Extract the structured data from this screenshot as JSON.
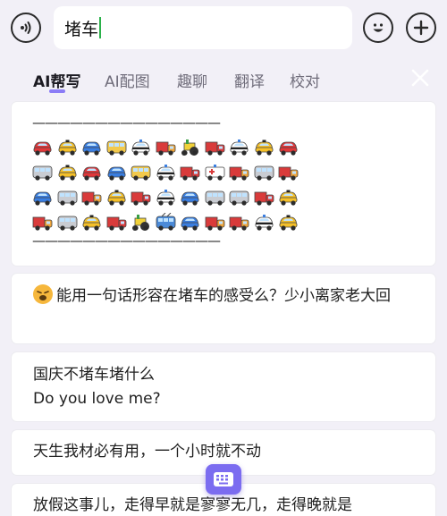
{
  "input": {
    "text": "堵车"
  },
  "tabs": [
    {
      "label": "AI帮写",
      "active": true
    },
    {
      "label": "AI配图",
      "active": false
    },
    {
      "label": "趣聊",
      "active": false
    },
    {
      "label": "翻译",
      "active": false
    },
    {
      "label": "校对",
      "active": false
    }
  ],
  "cards": {
    "vehicle_art": {
      "divider": "———————————————",
      "rows": [
        [
          "red-car",
          "taxi",
          "blue-car",
          "bus",
          "police-car",
          "truck",
          "tractor",
          "fire-engine",
          "police-car",
          "taxi",
          "red-car"
        ],
        [
          "minibus",
          "taxi",
          "red-car",
          "blue-car",
          "bus",
          "police-car",
          "fire-engine",
          "ambulance",
          "truck",
          "minibus",
          "truck"
        ],
        [
          "blue-car",
          "minibus",
          "truck",
          "taxi",
          "fire-engine",
          "police-car",
          "blue-car",
          "minibus",
          "minibus",
          "fire-engine",
          "taxi"
        ],
        [
          "truck",
          "minibus",
          "taxi",
          "fire-engine",
          "tractor",
          "trolleybus",
          "blue-car",
          "truck",
          "truck",
          "police-car",
          "taxi"
        ]
      ]
    },
    "suggestion_1": {
      "emoji": "tired-face",
      "text": "能用一句话形容在堵车的感受么？少小离家老大回"
    },
    "suggestion_2": {
      "line1": "国庆不堵车堵什么",
      "line2": "Do you love me?"
    },
    "suggestion_3": {
      "text": "天生我材必有用，一个小时就不动"
    },
    "suggestion_4": {
      "text": "放假这事儿，走得早就是寥寥无几，走得晚就是"
    }
  },
  "colors": {
    "accent": "#7b6cf0",
    "caret": "#2bb14a",
    "background": "#f2f0f7"
  }
}
